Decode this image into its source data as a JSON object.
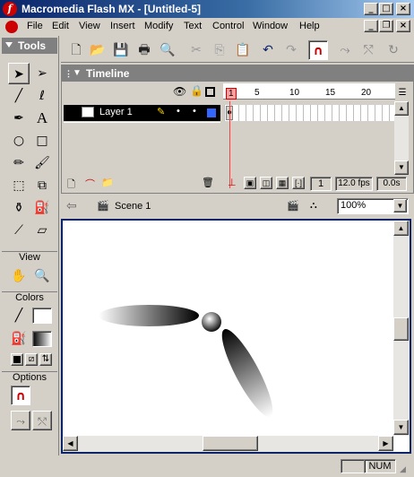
{
  "app": {
    "title": "Macromedia Flash MX - [Untitled-5]"
  },
  "menus": [
    "File",
    "Edit",
    "View",
    "Insert",
    "Modify",
    "Text",
    "Control",
    "Window",
    "Help"
  ],
  "tools_panel": {
    "title": "Tools",
    "view_label": "View",
    "colors_label": "Colors",
    "options_label": "Options"
  },
  "timeline": {
    "title": "Timeline",
    "layer_name": "Layer 1",
    "frame_markers": [
      "1",
      "5",
      "10",
      "15",
      "20"
    ],
    "current_frame": "1",
    "fps": "12.0 fps",
    "elapsed": "0.0s"
  },
  "scene": {
    "name": "Scene 1",
    "zoom": "100%"
  },
  "status": {
    "indicator": "NUM"
  },
  "colors": {
    "title_start": "#0a246a",
    "title_end": "#a6caf0",
    "playhead": "#ff4040",
    "stage_border": "#0a246a"
  }
}
